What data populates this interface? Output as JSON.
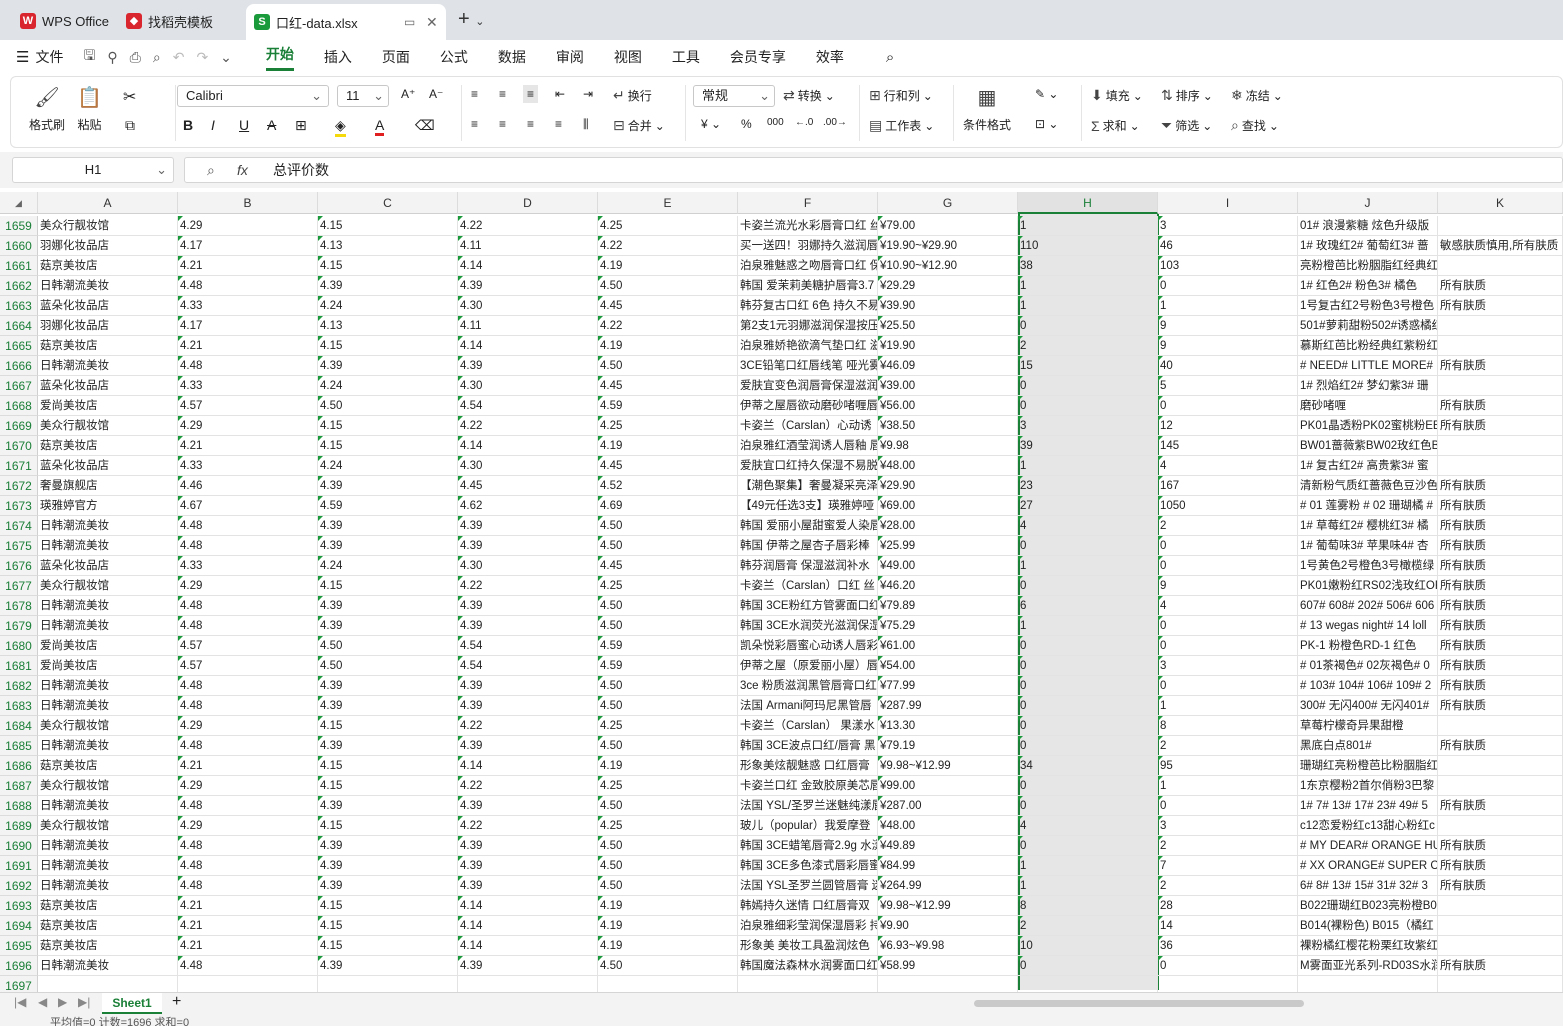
{
  "tabs": [
    {
      "label": "WPS Office",
      "color": "#d9262e"
    },
    {
      "label": "找稻壳模板",
      "color": "#d9262e"
    },
    {
      "label": "口红-data.xlsx",
      "color": "#1a9a3a"
    }
  ],
  "menu": {
    "file": "文件",
    "items": [
      "开始",
      "插入",
      "页面",
      "公式",
      "数据",
      "审阅",
      "视图",
      "工具",
      "会员专享",
      "效率"
    ],
    "active": "开始"
  },
  "ribbon": {
    "format_painter": "格式刷",
    "paste": "粘贴",
    "font_name": "Calibri",
    "font_size": "11",
    "wrap": "换行",
    "merge": "合并",
    "number_format": "常规",
    "convert": "转换",
    "row_col": "行和列",
    "worksheet": "工作表",
    "cond_format": "条件格式",
    "fill": "填充",
    "sort": "排序",
    "freeze": "冻结",
    "sum": "求和",
    "filter": "筛选",
    "find": "查找"
  },
  "formula_bar": {
    "cell_ref": "H1",
    "fx": "fx",
    "content": "总评价数"
  },
  "columns": [
    "A",
    "B",
    "C",
    "D",
    "E",
    "F",
    "G",
    "H",
    "I",
    "J",
    "K"
  ],
  "selected_column": "H",
  "rows": [
    {
      "n": "1659",
      "a": "美众行靓妆馆",
      "b": "4.29",
      "c": "4.15",
      "d": "4.22",
      "e": "4.25",
      "f": "卡姿兰流光水彩唇膏口红 丝",
      "g": "¥79.00",
      "h": "1",
      "i": "3",
      "j": "01# 浪漫紫糖 炫色升级版",
      "k": ""
    },
    {
      "n": "1660",
      "a": "羽娜化妆品店",
      "b": "4.17",
      "c": "4.13",
      "d": "4.11",
      "e": "4.22",
      "f": "买一送四！羽娜持久滋润唇",
      "g": "¥19.90~¥29.90",
      "h": "110",
      "i": "46",
      "j": "1# 玫瑰红2# 葡萄红3# 蔷",
      "k": "敏感肤质慎用,所有肤质"
    },
    {
      "n": "1661",
      "a": "菇京美妆店",
      "b": "4.21",
      "c": "4.15",
      "d": "4.14",
      "e": "4.19",
      "f": "泊泉雅魅惑之吻唇膏口红 保",
      "g": "¥10.90~¥12.90",
      "h": "38",
      "i": "103",
      "j": "亮粉橙芭比粉胭脂红经典红",
      "k": ""
    },
    {
      "n": "1662",
      "a": "日韩潮流美妆",
      "b": "4.48",
      "c": "4.39",
      "d": "4.39",
      "e": "4.50",
      "f": "韩国 爱茉莉美糖护唇膏3.7",
      "g": "¥29.29",
      "h": "1",
      "i": "0",
      "j": "1# 红色2# 粉色3# 橘色",
      "k": "所有肤质"
    },
    {
      "n": "1663",
      "a": "蓝朵化妆品店",
      "b": "4.33",
      "c": "4.24",
      "d": "4.30",
      "e": "4.45",
      "f": "韩芬复古口红 6色 持久不易",
      "g": "¥39.90",
      "h": "1",
      "i": "1",
      "j": "1号复古红2号粉色3号橙色",
      "k": "所有肤质"
    },
    {
      "n": "1664",
      "a": "羽娜化妆品店",
      "b": "4.17",
      "c": "4.13",
      "d": "4.11",
      "e": "4.22",
      "f": "第2支1元羽娜滋润保湿按压",
      "g": "¥25.50",
      "h": "0",
      "i": "9",
      "j": "501#萝莉甜粉502#诱惑橘红",
      "k": ""
    },
    {
      "n": "1665",
      "a": "菇京美妆店",
      "b": "4.21",
      "c": "4.15",
      "d": "4.14",
      "e": "4.19",
      "f": "泊泉雅娇艳欲滴气垫口红 滋",
      "g": "¥19.90",
      "h": "2",
      "i": "9",
      "j": "慕斯红芭比粉经典红紫粉红",
      "k": ""
    },
    {
      "n": "1666",
      "a": "日韩潮流美妆",
      "b": "4.48",
      "c": "4.39",
      "d": "4.39",
      "e": "4.50",
      "f": "3CE铅笔口红唇线笔 哑光雾",
      "g": "¥46.09",
      "h": "15",
      "i": "40",
      "j": "# NEED# LITTLE MORE# B",
      "k": "所有肤质"
    },
    {
      "n": "1667",
      "a": "蓝朵化妆品店",
      "b": "4.33",
      "c": "4.24",
      "d": "4.30",
      "e": "4.45",
      "f": "爱肤宜变色润唇膏保湿滋润",
      "g": "¥39.00",
      "h": "0",
      "i": "5",
      "j": "1# 烈焰红2# 梦幻紫3# 珊",
      "k": ""
    },
    {
      "n": "1668",
      "a": "爱尚美妆店",
      "b": "4.57",
      "c": "4.50",
      "d": "4.54",
      "e": "4.59",
      "f": "伊蒂之屋唇欲动磨砂啫喱唇",
      "g": "¥56.00",
      "h": "0",
      "i": "0",
      "j": "磨砂啫喱",
      "k": "所有肤质"
    },
    {
      "n": "1669",
      "a": "美众行靓妆馆",
      "b": "4.29",
      "c": "4.15",
      "d": "4.22",
      "e": "4.25",
      "f": "卡姿兰（Carslan）心动诱",
      "g": "¥38.50",
      "h": "3",
      "i": "12",
      "j": "PK01晶透粉PK02蜜桃粉EB0",
      "k": "所有肤质"
    },
    {
      "n": "1670",
      "a": "菇京美妆店",
      "b": "4.21",
      "c": "4.15",
      "d": "4.14",
      "e": "4.19",
      "f": "泊泉雅红酒莹润诱人唇釉 唇",
      "g": "¥9.98",
      "h": "39",
      "i": "145",
      "j": "BW01蔷薇紫BW02玫红色B",
      "k": ""
    },
    {
      "n": "1671",
      "a": "蓝朵化妆品店",
      "b": "4.33",
      "c": "4.24",
      "d": "4.30",
      "e": "4.45",
      "f": "爱肤宜口红持久保湿不易脱",
      "g": "¥48.00",
      "h": "1",
      "i": "4",
      "j": "1# 复古红2# 高贵紫3# 蜜",
      "k": ""
    },
    {
      "n": "1672",
      "a": "奢曼旗舰店",
      "b": "4.46",
      "c": "4.39",
      "d": "4.45",
      "e": "4.52",
      "f": "【潮色聚集】奢曼凝采亮泽",
      "g": "¥29.90",
      "h": "23",
      "i": "167",
      "j": "清新粉气质红蔷薇色豆沙色",
      "k": "所有肤质"
    },
    {
      "n": "1673",
      "a": "瑛雅婷官方",
      "b": "4.67",
      "c": "4.59",
      "d": "4.62",
      "e": "4.69",
      "f": "【49元任选3支】瑛雅婷哑",
      "g": "¥69.00",
      "h": "27",
      "i": "1050",
      "j": "# 01 莲雾粉 # 02 珊瑚橘 #",
      "k": "所有肤质"
    },
    {
      "n": "1674",
      "a": "日韩潮流美妆",
      "b": "4.48",
      "c": "4.39",
      "d": "4.39",
      "e": "4.50",
      "f": "韩国 爱丽小屋甜蜜爱人染唇",
      "g": "¥28.00",
      "h": "4",
      "i": "2",
      "j": "1# 草莓红2# 樱桃红3# 橘",
      "k": "所有肤质"
    },
    {
      "n": "1675",
      "a": "日韩潮流美妆",
      "b": "4.48",
      "c": "4.39",
      "d": "4.39",
      "e": "4.50",
      "f": "韩国 伊蒂之屋杏子唇彩棒",
      "g": "¥25.99",
      "h": "0",
      "i": "0",
      "j": "1# 葡萄味3# 苹果味4# 杏",
      "k": "所有肤质"
    },
    {
      "n": "1676",
      "a": "蓝朵化妆品店",
      "b": "4.33",
      "c": "4.24",
      "d": "4.30",
      "e": "4.45",
      "f": "韩芬润唇膏 保湿滋润补水",
      "g": "¥49.00",
      "h": "1",
      "i": "0",
      "j": "1号黄色2号橙色3号橄榄绿",
      "k": "所有肤质"
    },
    {
      "n": "1677",
      "a": "美众行靓妆馆",
      "b": "4.29",
      "c": "4.15",
      "d": "4.22",
      "e": "4.25",
      "f": "卡姿兰（Carslan）口红 丝",
      "g": "¥46.20",
      "h": "0",
      "i": "9",
      "j": "PK01嫩粉红RS02浅玫红OR",
      "k": "所有肤质"
    },
    {
      "n": "1678",
      "a": "日韩潮流美妆",
      "b": "4.48",
      "c": "4.39",
      "d": "4.39",
      "e": "4.50",
      "f": "韩国 3CE粉红方管雾面口红",
      "g": "¥79.89",
      "h": "6",
      "i": "4",
      "j": "607# 608# 202# 506# 606",
      "k": "所有肤质"
    },
    {
      "n": "1679",
      "a": "日韩潮流美妆",
      "b": "4.48",
      "c": "4.39",
      "d": "4.39",
      "e": "4.50",
      "f": "韩国 3CE水润荧光滋润保湿",
      "g": "¥75.29",
      "h": "1",
      "i": "0",
      "j": "# 13 wegas night# 14 loll",
      "k": "所有肤质"
    },
    {
      "n": "1680",
      "a": "爱尚美妆店",
      "b": "4.57",
      "c": "4.50",
      "d": "4.54",
      "e": "4.59",
      "f": "凯朵悦彩唇蜜心动诱人唇彩",
      "g": "¥61.00",
      "h": "0",
      "i": "0",
      "j": "PK-1 粉橙色RD-1 红色",
      "k": "所有肤质"
    },
    {
      "n": "1681",
      "a": "爱尚美妆店",
      "b": "4.57",
      "c": "4.50",
      "d": "4.54",
      "e": "4.59",
      "f": "伊蒂之屋（原爱丽小屋）唇",
      "g": "¥54.00",
      "h": "0",
      "i": "3",
      "j": "# 01茶褐色# 02灰褐色# 0",
      "k": "所有肤质"
    },
    {
      "n": "1682",
      "a": "日韩潮流美妆",
      "b": "4.48",
      "c": "4.39",
      "d": "4.39",
      "e": "4.50",
      "f": "3ce 粉质滋润黑管唇膏口红",
      "g": "¥77.99",
      "h": "0",
      "i": "0",
      "j": "# 103# 104# 106# 109# 2",
      "k": "所有肤质"
    },
    {
      "n": "1683",
      "a": "日韩潮流美妆",
      "b": "4.48",
      "c": "4.39",
      "d": "4.39",
      "e": "4.50",
      "f": "法国 Armani阿玛尼黑管唇",
      "g": "¥287.99",
      "h": "0",
      "i": "1",
      "j": "300# 无闪400# 无闪401#",
      "k": "所有肤质"
    },
    {
      "n": "1684",
      "a": "美众行靓妆馆",
      "b": "4.29",
      "c": "4.15",
      "d": "4.22",
      "e": "4.25",
      "f": "卡姿兰（Carslan） 果漾水",
      "g": "¥13.30",
      "h": "0",
      "i": "8",
      "j": "草莓柠檬奇异果甜橙",
      "k": ""
    },
    {
      "n": "1685",
      "a": "日韩潮流美妆",
      "b": "4.48",
      "c": "4.39",
      "d": "4.39",
      "e": "4.50",
      "f": "韩国 3CE波点口红/唇膏 黑",
      "g": "¥79.19",
      "h": "0",
      "i": "2",
      "j": "黑底白点801#",
      "k": "所有肤质"
    },
    {
      "n": "1686",
      "a": "菇京美妆店",
      "b": "4.21",
      "c": "4.15",
      "d": "4.14",
      "e": "4.19",
      "f": "形象美炫靓魅惑 口红唇膏",
      "g": "¥9.98~¥12.99",
      "h": "34",
      "i": "95",
      "j": "珊瑚红亮粉橙芭比粉胭脂红",
      "k": ""
    },
    {
      "n": "1687",
      "a": "美众行靓妆馆",
      "b": "4.29",
      "c": "4.15",
      "d": "4.22",
      "e": "4.25",
      "f": "卡姿兰口红 金致胶原美芯唇",
      "g": "¥99.00",
      "h": "0",
      "i": "1",
      "j": "1东京樱粉2首尔俏粉3巴黎",
      "k": ""
    },
    {
      "n": "1688",
      "a": "日韩潮流美妆",
      "b": "4.48",
      "c": "4.39",
      "d": "4.39",
      "e": "4.50",
      "f": "法国 YSL/圣罗兰迷魅纯漾唇",
      "g": "¥287.00",
      "h": "0",
      "i": "0",
      "j": "1# 7# 13# 17# 23# 49# 5",
      "k": "所有肤质"
    },
    {
      "n": "1689",
      "a": "美众行靓妆馆",
      "b": "4.29",
      "c": "4.15",
      "d": "4.22",
      "e": "4.25",
      "f": "玻儿（popular）我爱摩登",
      "g": "¥48.00",
      "h": "4",
      "i": "3",
      "j": "c12恋爱粉红c13甜心粉红c",
      "k": ""
    },
    {
      "n": "1690",
      "a": "日韩潮流美妆",
      "b": "4.48",
      "c": "4.39",
      "d": "4.39",
      "e": "4.50",
      "f": "韩国 3CE蜡笔唇膏2.9g 水漾",
      "g": "¥49.89",
      "h": "0",
      "i": "2",
      "j": "# MY DEAR# ORANGE HU",
      "k": "所有肤质"
    },
    {
      "n": "1691",
      "a": "日韩潮流美妆",
      "b": "4.48",
      "c": "4.39",
      "d": "4.39",
      "e": "4.50",
      "f": "韩国 3CE多色漆式唇彩唇蜜",
      "g": "¥84.99",
      "h": "1",
      "i": "7",
      "j": "# XX ORANGE# SUPER COR",
      "k": "所有肤质"
    },
    {
      "n": "1692",
      "a": "日韩潮流美妆",
      "b": "4.48",
      "c": "4.39",
      "d": "4.39",
      "e": "4.50",
      "f": "法国 YSL圣罗兰圆管唇膏 迷",
      "g": "¥264.99",
      "h": "1",
      "i": "2",
      "j": "6# 8# 13# 15# 31# 32# 3",
      "k": "所有肤质"
    },
    {
      "n": "1693",
      "a": "菇京美妆店",
      "b": "4.21",
      "c": "4.15",
      "d": "4.14",
      "e": "4.19",
      "f": "韩嫣持久迷情 口红唇膏双",
      "g": "¥9.98~¥12.99",
      "h": "8",
      "i": "28",
      "j": "B022珊瑚红B023亮粉橙B02",
      "k": ""
    },
    {
      "n": "1694",
      "a": "菇京美妆店",
      "b": "4.21",
      "c": "4.15",
      "d": "4.14",
      "e": "4.19",
      "f": "泊泉雅细彩莹润保湿唇彩 持",
      "g": "¥9.90",
      "h": "2",
      "i": "14",
      "j": "B014(裸粉色) B015（橘红",
      "k": ""
    },
    {
      "n": "1695",
      "a": "菇京美妆店",
      "b": "4.21",
      "c": "4.15",
      "d": "4.14",
      "e": "4.19",
      "f": "形象美 美妆工具盈润炫色",
      "g": "¥6.93~¥9.98",
      "h": "10",
      "i": "36",
      "j": "裸粉橘红樱花粉栗红玫紫红",
      "k": ""
    },
    {
      "n": "1696",
      "a": "日韩潮流美妆",
      "b": "4.48",
      "c": "4.39",
      "d": "4.39",
      "e": "4.50",
      "f": "韩国魔法森林水润雾面口红",
      "g": "¥58.99",
      "h": "0",
      "i": "0",
      "j": "M雾面亚光系列-RD03S水润",
      "k": "所有肤质"
    },
    {
      "n": "1697",
      "a": "",
      "b": "",
      "c": "",
      "d": "",
      "e": "",
      "f": "",
      "g": "",
      "h": "",
      "i": "",
      "j": "",
      "k": ""
    }
  ],
  "sheet_tab": "Sheet1",
  "status": "平均值=0 计数=1696 求和=0",
  "accent": "#1a7f37"
}
